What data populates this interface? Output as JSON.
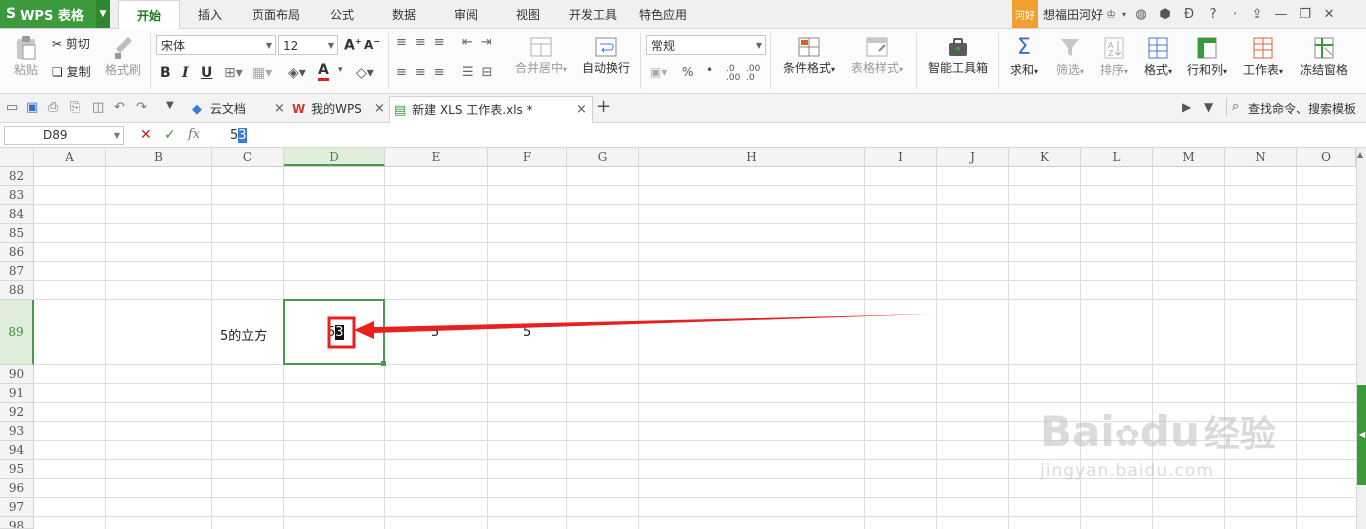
{
  "app": {
    "logo_glyph": "S",
    "name": "WPS 表格",
    "menu_tabs": [
      "开始",
      "插入",
      "页面布局",
      "公式",
      "数据",
      "审阅",
      "视图",
      "开发工具",
      "特色应用"
    ],
    "user_badge": "河好",
    "user_name": "想福田河好"
  },
  "ribbon": {
    "paste": "粘贴",
    "cut": "剪切",
    "copy": "复制",
    "format_painter": "格式刷",
    "font_name": "宋体",
    "font_size": "12",
    "bold": "B",
    "italic": "I",
    "underline": "U",
    "font_color_glyph": "A",
    "merge_center": "合并居中",
    "wrap_text": "自动换行",
    "number_format": "常规",
    "percent": "%",
    "comma": "•",
    "conditional_format": "条件格式",
    "table_style": "表格样式",
    "smart_toolbox": "智能工具箱",
    "sum": "求和",
    "filter": "筛选",
    "sort": "排序",
    "format": "格式",
    "row_col": "行和列",
    "worksheet": "工作表",
    "freeze_panes": "冻结窗格"
  },
  "docbar": {
    "tabs": [
      {
        "label": "云文档",
        "active": false
      },
      {
        "label": "我的WPS",
        "active": false
      },
      {
        "label": "新建 XLS 工作表.xls *",
        "active": true
      }
    ],
    "add_tab": "+",
    "close_glyph": "×",
    "search": "查找命令、搜索模板"
  },
  "formula_bar": {
    "name_box": "D89",
    "cancel_glyph": "✕",
    "confirm_glyph": "✓",
    "fx_glyph": "fx",
    "content": "5",
    "content_selected": "3"
  },
  "sheet": {
    "columns": [
      "A",
      "B",
      "C",
      "D",
      "E",
      "F",
      "G",
      "H",
      "I",
      "J",
      "K",
      "L",
      "M",
      "N",
      "O"
    ],
    "active_column": "D",
    "rows": [
      "82",
      "83",
      "84",
      "85",
      "86",
      "87",
      "88",
      "89",
      "90",
      "91",
      "92",
      "93",
      "94",
      "95",
      "96",
      "97",
      "98"
    ],
    "active_row": "89",
    "cells": {
      "C89": "5的立方",
      "D89_base": "5",
      "D89_selected": "3",
      "E89": "5",
      "F89": "5"
    }
  },
  "annotation": {
    "arrow_color": "#e82020"
  },
  "watermark": {
    "brand": "Bai",
    "brand_suffix": "du",
    "cn": "经验",
    "url": "jingyan.baidu.com"
  }
}
